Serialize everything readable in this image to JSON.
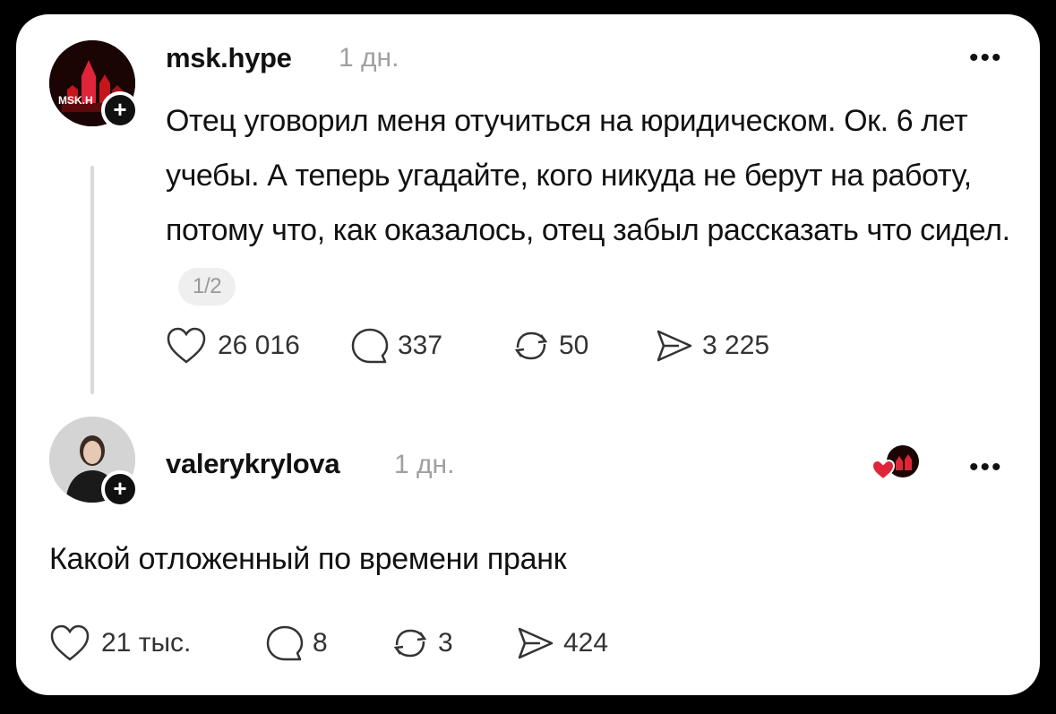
{
  "post": {
    "username": "msk.hype",
    "time": "1 дн.",
    "avatar_text": "MSK.H",
    "text": "Отец уговорил меня отучиться на юридическом. Ок. 6 лет учебы. А теперь угадайте, кого никуда не берут на работу, потому что, как оказалось, отец забыл рассказать что сидел.",
    "pager": "1/2",
    "stats": {
      "likes": "26 016",
      "comments": "337",
      "reposts": "50",
      "shares": "3 225"
    }
  },
  "reply": {
    "username": "valerykrylova",
    "time": "1 дн.",
    "text": "Какой отложенный по времени пранк",
    "stats": {
      "likes": "21 тыс.",
      "comments": "8",
      "reposts": "3",
      "shares": "424"
    }
  },
  "icons": {
    "heart": "heart-icon",
    "comment": "comment-icon",
    "repost": "repost-icon",
    "share": "share-icon",
    "more": "more-options-icon",
    "follow": "plus-icon"
  },
  "colors": {
    "background": "#000000",
    "card": "#ffffff",
    "muted": "#a0a0a0",
    "accent_red": "#e0243a"
  }
}
